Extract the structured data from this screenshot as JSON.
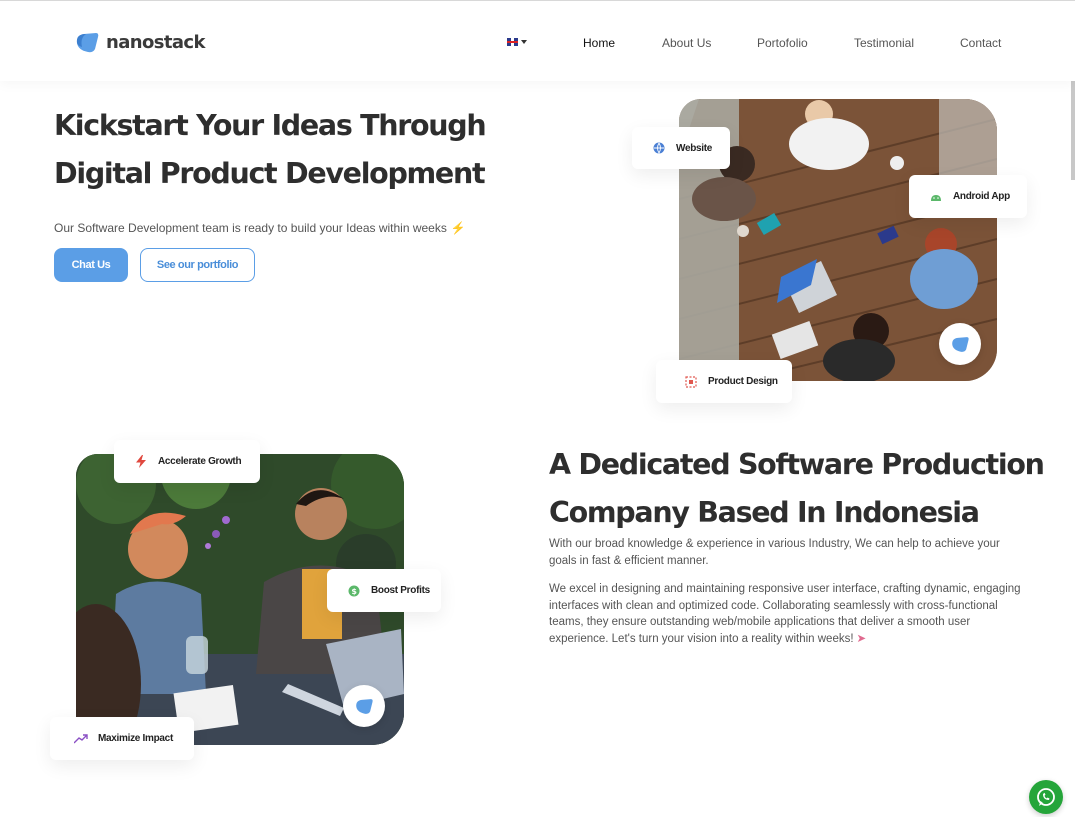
{
  "brand": {
    "name": "nanostack",
    "accent": "#5b9ee6"
  },
  "nav": {
    "language": "EN",
    "items": [
      {
        "label": "Home",
        "active": true
      },
      {
        "label": "About Us"
      },
      {
        "label": "Portofolio"
      },
      {
        "label": "Testimonial"
      },
      {
        "label": "Contact"
      }
    ]
  },
  "hero": {
    "title_line1": "Kickstart Your Ideas Through",
    "title_line2": "Digital Product Development",
    "subtitle": "Our Software Development team is ready to build your Ideas within weeks",
    "primary_cta": "Chat Us",
    "secondary_cta": "See our portfolio",
    "badges": [
      {
        "label": "Website",
        "icon": "globe-icon"
      },
      {
        "label": "Android App",
        "icon": "android-icon"
      },
      {
        "label": "Product Design",
        "icon": "design-icon"
      }
    ]
  },
  "about": {
    "title_line1": "A Dedicated Software Production",
    "title_line2": "Company Based In Indonesia",
    "paragraph1": "With our broad knowledge & experience in various Industry, We can help to achieve your goals in fast & efficient manner.",
    "paragraph2": "We excel in designing and maintaining responsive user interface, crafting dynamic, engaging interfaces with clean and optimized code. Collaborating seamlessly with cross-functional teams, they ensure outstanding web/mobile applications that deliver a smooth user experience. Let's turn your vision into a reality within weeks!",
    "badges": [
      {
        "label": "Accelerate Growth",
        "icon": "bolt-icon"
      },
      {
        "label": "Boost Profits",
        "icon": "dollar-icon"
      },
      {
        "label": "Maximize Impact",
        "icon": "trend-icon"
      }
    ]
  },
  "floating": {
    "whatsapp": "whatsapp-icon"
  }
}
